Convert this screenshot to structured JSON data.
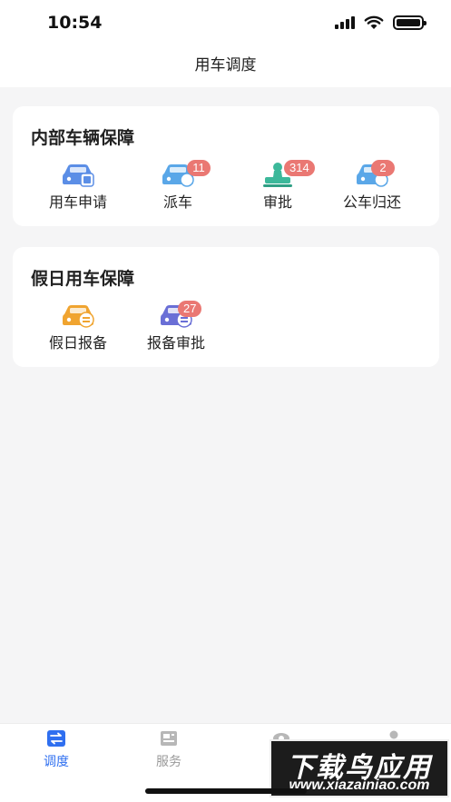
{
  "status_bar": {
    "time": "10:54"
  },
  "nav": {
    "title": "用车调度"
  },
  "sections": [
    {
      "title": "内部车辆保障",
      "items": [
        {
          "label": "用车申请",
          "badge": "",
          "icon": "car-apply-icon"
        },
        {
          "label": "派车",
          "badge": "11",
          "icon": "car-dispatch-icon"
        },
        {
          "label": "审批",
          "badge": "314",
          "icon": "approval-stamp-icon"
        },
        {
          "label": "公车归还",
          "badge": "2",
          "icon": "car-return-icon"
        }
      ]
    },
    {
      "title": "假日用车保障",
      "items": [
        {
          "label": "假日报备",
          "badge": "",
          "icon": "car-report-icon"
        },
        {
          "label": "报备审批",
          "badge": "27",
          "icon": "report-approval-icon"
        }
      ]
    }
  ],
  "tabs": [
    {
      "label": "调度",
      "active": true
    },
    {
      "label": "服务",
      "active": false
    },
    {
      "label": "",
      "active": false
    },
    {
      "label": "",
      "active": false
    }
  ],
  "watermark": {
    "title": "下载鸟应用",
    "url": "www.xiazainiao.com"
  },
  "colors": {
    "accent": "#2f6ff0",
    "badge": "#ea7873",
    "car_blue": "#5b8ee6",
    "car_orange": "#f0a430",
    "stamp_green": "#3cb89a",
    "car_purple": "#6a6fd6"
  }
}
